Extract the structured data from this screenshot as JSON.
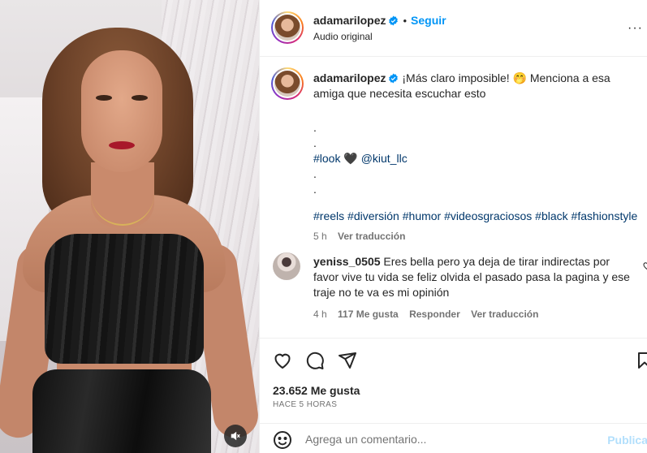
{
  "post": {
    "username": "adamarilopez",
    "follow_label": "Seguir",
    "separator": "•",
    "audio": "Audio original",
    "more_label": "···"
  },
  "caption": {
    "username": "adamarilopez",
    "text": "¡Más claro imposible! 🤭 Menciona a esa amiga que necesita escuchar esto",
    "dot1": ".",
    "dot2": ".",
    "tag_look": "#look",
    "heart": "🖤",
    "mention": "@kiut_llc",
    "dot3": ".",
    "dot4": ".",
    "hashtags": [
      "#reels",
      "#diversión",
      "#humor",
      "#videosgraciosos",
      "#black",
      "#fashionstyle"
    ],
    "time": "5 h",
    "translate": "Ver traducción"
  },
  "comment": {
    "username": "yeniss_0505",
    "text": "Eres bella pero ya deja de tirar indirectas por favor vive tu vida se feliz olvida el pasado pasa la pagina y ese traje no te va es mi opinión",
    "time": "4 h",
    "likes": "117 Me gusta",
    "reply": "Responder",
    "translate": "Ver traducción"
  },
  "stats": {
    "likes": "23.652 Me gusta",
    "posted": "HACE 5 HORAS"
  },
  "composer": {
    "placeholder": "Agrega un comentario...",
    "publish": "Publica"
  },
  "colors": {
    "link_blue": "#0095f6",
    "tag_blue": "#00376b",
    "muted": "#737373",
    "text": "#262626"
  },
  "icons": [
    "verified-badge-icon",
    "more-options-icon",
    "heart-icon",
    "comment-icon",
    "share-icon",
    "bookmark-icon",
    "emoji-icon",
    "mute-icon"
  ]
}
